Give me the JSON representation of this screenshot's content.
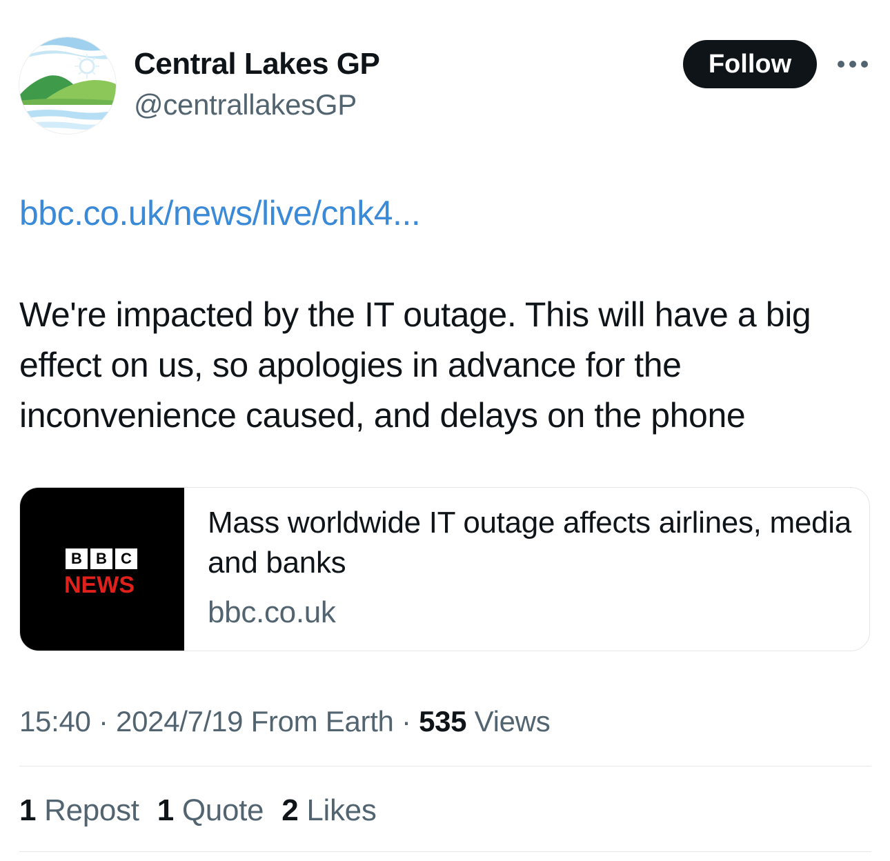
{
  "author": {
    "display_name": "Central Lakes GP",
    "handle": "@centrallakesGP",
    "avatar": "lakes-landscape-avatar"
  },
  "header": {
    "follow_label": "Follow",
    "more_icon": "more-horizontal-icon"
  },
  "tweet": {
    "link": "bbc.co.uk/news/live/cnk4...",
    "text": "We're impacted by the IT outage. This will have a big effect on us, so apologies in advance for the inconvenience caused, and delays on the phone"
  },
  "card": {
    "logo_letters": [
      "B",
      "B",
      "C"
    ],
    "logo_word": "NEWS",
    "title": "Mass worldwide IT outage affects airlines, media and banks",
    "domain": "bbc.co.uk"
  },
  "meta": {
    "time": "15:40",
    "separator": "·",
    "date": "2024/7/19",
    "location": "From Earth",
    "views_count": "535",
    "views_label": "Views"
  },
  "stats": {
    "reposts_count": "1",
    "reposts_label": "Repost",
    "quotes_count": "1",
    "quotes_label": "Quote",
    "likes_count": "2",
    "likes_label": "Likes"
  },
  "colors": {
    "link": "#3b8ad8",
    "secondary_text": "#536471",
    "primary_text": "#0f1419",
    "bbc_news_red": "#e0201b"
  }
}
